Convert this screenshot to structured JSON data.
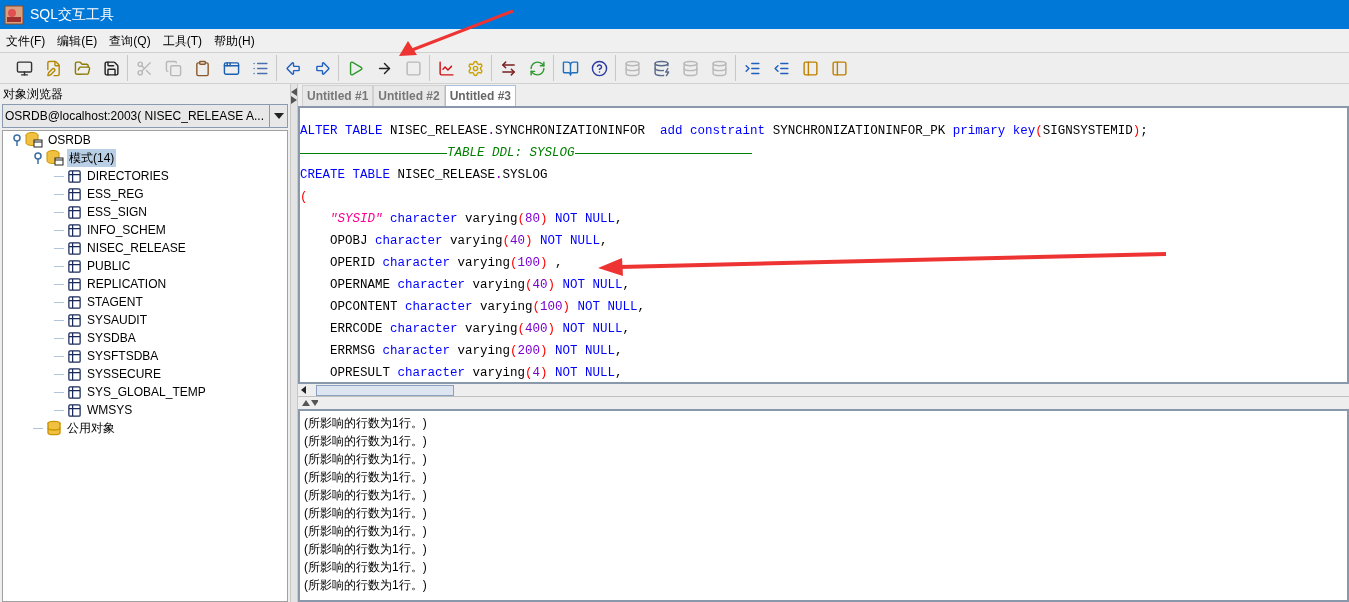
{
  "window": {
    "title": "SQL交互工具"
  },
  "menu": [
    "文件(F)",
    "编辑(E)",
    "查询(Q)",
    "工具(T)",
    "帮助(H)"
  ],
  "toolbar": [
    [
      {
        "disabled": false
      },
      {
        "disabled": false
      },
      {
        "disabled": false
      },
      {
        "disabled": false
      }
    ],
    [
      {
        "disabled": true
      },
      {
        "disabled": true
      },
      {
        "disabled": false
      },
      {
        "disabled": false
      },
      {
        "disabled": false
      }
    ],
    [
      {
        "disabled": false
      },
      {
        "disabled": false
      }
    ],
    [
      {
        "disabled": false
      },
      {
        "disabled": false
      },
      {
        "disabled": true
      }
    ],
    [
      {
        "disabled": false
      },
      {
        "disabled": false
      }
    ],
    [
      {
        "disabled": false
      },
      {
        "disabled": false
      }
    ],
    [
      {
        "disabled": false
      },
      {
        "disabled": false
      }
    ],
    [
      {
        "disabled": true
      },
      {
        "disabled": false
      },
      {
        "disabled": true
      },
      {
        "disabled": true
      }
    ],
    [
      {
        "disabled": false
      },
      {
        "disabled": false
      },
      {
        "disabled": false
      },
      {
        "disabled": false
      }
    ]
  ],
  "object_browser": {
    "title": "对象浏览器",
    "connection": "OSRDB@localhost:2003( NISEC_RELEASE A...",
    "tree": [
      {
        "label": "OSRDB",
        "kind": "container",
        "expanded": true,
        "selected": false,
        "children": [
          {
            "label": "模式(14)",
            "kind": "container",
            "expanded": true,
            "selected": true,
            "children": [
              {
                "label": "DIRECTORIES",
                "kind": "schema",
                "selected": false
              },
              {
                "label": "ESS_REG",
                "kind": "schema",
                "selected": false
              },
              {
                "label": "ESS_SIGN",
                "kind": "schema",
                "selected": false
              },
              {
                "label": "INFO_SCHEM",
                "kind": "schema",
                "selected": false
              },
              {
                "label": "NISEC_RELEASE",
                "kind": "schema",
                "selected": false
              },
              {
                "label": "PUBLIC",
                "kind": "schema",
                "selected": false
              },
              {
                "label": "REPLICATION",
                "kind": "schema",
                "selected": false
              },
              {
                "label": "STAGENT",
                "kind": "schema",
                "selected": false
              },
              {
                "label": "SYSAUDIT",
                "kind": "schema",
                "selected": false
              },
              {
                "label": "SYSDBA",
                "kind": "schema",
                "selected": false
              },
              {
                "label": "SYSFTSDBA",
                "kind": "schema",
                "selected": false
              },
              {
                "label": "SYSSECURE",
                "kind": "schema",
                "selected": false
              },
              {
                "label": "SYS_GLOBAL_TEMP",
                "kind": "schema",
                "selected": false
              },
              {
                "label": "WMSYS",
                "kind": "schema",
                "selected": false
              }
            ]
          },
          {
            "label": "公用对象",
            "kind": "public",
            "selected": false
          }
        ]
      }
    ]
  },
  "tabs": [
    {
      "label": "Untitled #1",
      "selected": false
    },
    {
      "label": "Untitled #2",
      "selected": false
    },
    {
      "label": "Untitled #3",
      "selected": true
    }
  ],
  "editor_lines": [
    {
      "indent": false,
      "tokens": [
        {
          "kind": "kw",
          "text": "ALTER TABLE"
        },
        {
          "kind": "p",
          "text": " NISEC_RELEASE"
        },
        {
          "kind": "dot",
          "text": "."
        },
        {
          "kind": "p",
          "text": "SYNCHRONIZATIONINFOR  "
        },
        {
          "kind": "kw",
          "text": "add constraint"
        },
        {
          "kind": "p",
          "text": " SYNCHRONIZATIONINFOR_PK "
        },
        {
          "kind": "kw",
          "text": "primary key"
        },
        {
          "kind": "par",
          "text": "("
        },
        {
          "kind": "p",
          "text": "SIGNSYSTEMID"
        },
        {
          "kind": "par",
          "text": ")"
        },
        {
          "kind": "p",
          "text": ";"
        }
      ]
    },
    {
      "indent": false,
      "tokens": [
        {
          "kind": "cm",
          "text": "TABLE DDL: SYSLOG"
        }
      ]
    },
    {
      "indent": false,
      "tokens": [
        {
          "kind": "kw",
          "text": "CREATE TABLE"
        },
        {
          "kind": "p",
          "text": " NISEC_RELEASE"
        },
        {
          "kind": "dot",
          "text": "."
        },
        {
          "kind": "p",
          "text": "SYSLOG"
        }
      ]
    },
    {
      "indent": false,
      "tokens": [
        {
          "kind": "par",
          "text": "("
        }
      ]
    },
    {
      "indent": true,
      "tokens": [
        {
          "kind": "str",
          "text": "\"SYSID\""
        },
        {
          "kind": "kw",
          "text": " character"
        },
        {
          "kind": "p",
          "text": " varying"
        },
        {
          "kind": "par",
          "text": "("
        },
        {
          "kind": "num",
          "text": "80"
        },
        {
          "kind": "par",
          "text": ")"
        },
        {
          "kind": "kw",
          "text": " NOT NULL"
        },
        {
          "kind": "p",
          "text": ","
        }
      ]
    },
    {
      "indent": true,
      "tokens": [
        {
          "kind": "p",
          "text": "OPOBJ "
        },
        {
          "kind": "kw",
          "text": "character"
        },
        {
          "kind": "p",
          "text": " varying"
        },
        {
          "kind": "par",
          "text": "("
        },
        {
          "kind": "num",
          "text": "40"
        },
        {
          "kind": "par",
          "text": ")"
        },
        {
          "kind": "kw",
          "text": " NOT NULL"
        },
        {
          "kind": "p",
          "text": ","
        }
      ]
    },
    {
      "indent": true,
      "tokens": [
        {
          "kind": "p",
          "text": "OPERID "
        },
        {
          "kind": "kw",
          "text": "character"
        },
        {
          "kind": "p",
          "text": " varying"
        },
        {
          "kind": "par",
          "text": "("
        },
        {
          "kind": "num",
          "text": "100"
        },
        {
          "kind": "par",
          "text": ")"
        },
        {
          "kind": "p",
          "text": " ,"
        }
      ]
    },
    {
      "indent": true,
      "tokens": [
        {
          "kind": "p",
          "text": "OPERNAME "
        },
        {
          "kind": "kw",
          "text": "character"
        },
        {
          "kind": "p",
          "text": " varying"
        },
        {
          "kind": "par",
          "text": "("
        },
        {
          "kind": "num",
          "text": "40"
        },
        {
          "kind": "par",
          "text": ")"
        },
        {
          "kind": "kw",
          "text": " NOT NULL"
        },
        {
          "kind": "p",
          "text": ","
        }
      ]
    },
    {
      "indent": true,
      "tokens": [
        {
          "kind": "p",
          "text": "OPCONTENT "
        },
        {
          "kind": "kw",
          "text": "character"
        },
        {
          "kind": "p",
          "text": " varying"
        },
        {
          "kind": "par",
          "text": "("
        },
        {
          "kind": "num",
          "text": "100"
        },
        {
          "kind": "par",
          "text": ")"
        },
        {
          "kind": "kw",
          "text": " NOT NULL"
        },
        {
          "kind": "p",
          "text": ","
        }
      ]
    },
    {
      "indent": true,
      "tokens": [
        {
          "kind": "p",
          "text": "ERRCODE "
        },
        {
          "kind": "kw",
          "text": "character"
        },
        {
          "kind": "p",
          "text": " varying"
        },
        {
          "kind": "par",
          "text": "("
        },
        {
          "kind": "num",
          "text": "400"
        },
        {
          "kind": "par",
          "text": ")"
        },
        {
          "kind": "kw",
          "text": " NOT NULL"
        },
        {
          "kind": "p",
          "text": ","
        }
      ]
    },
    {
      "indent": true,
      "tokens": [
        {
          "kind": "p",
          "text": "ERRMSG "
        },
        {
          "kind": "kw",
          "text": "character"
        },
        {
          "kind": "p",
          "text": " varying"
        },
        {
          "kind": "par",
          "text": "("
        },
        {
          "kind": "num",
          "text": "200"
        },
        {
          "kind": "par",
          "text": ")"
        },
        {
          "kind": "kw",
          "text": " NOT NULL"
        },
        {
          "kind": "p",
          "text": ","
        }
      ]
    },
    {
      "indent": true,
      "tokens": [
        {
          "kind": "p",
          "text": "OPRESULT "
        },
        {
          "kind": "kw",
          "text": "character"
        },
        {
          "kind": "p",
          "text": " varying"
        },
        {
          "kind": "par",
          "text": "("
        },
        {
          "kind": "num",
          "text": "4"
        },
        {
          "kind": "par",
          "text": ")"
        },
        {
          "kind": "kw",
          "text": " NOT NULL"
        },
        {
          "kind": "p",
          "text": ","
        }
      ]
    }
  ],
  "output_lines": [
    "(所影响的行数为1行。)",
    "(所影响的行数为1行。)",
    "(所影响的行数为1行。)",
    "(所影响的行数为1行。)",
    "(所影响的行数为1行。)",
    "(所影响的行数为1行。)",
    "(所影响的行数为1行。)",
    "(所影响的行数为1行。)",
    "(所影响的行数为1行。)",
    "(所影响的行数为1行。)"
  ]
}
